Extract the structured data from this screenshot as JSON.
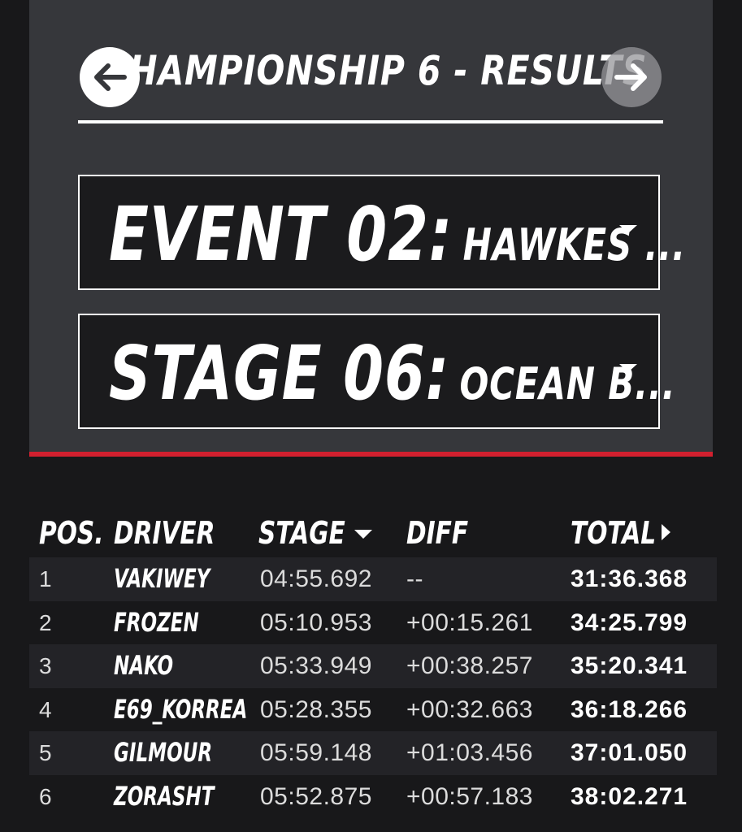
{
  "header": {
    "title": "CHAMPIONSHIP 6 - RESULTS",
    "prev_icon": "arrow-left-icon",
    "next_icon": "arrow-right-icon"
  },
  "event_selector": {
    "label": "EVENT 02:",
    "value": "HAWKES ..."
  },
  "stage_selector": {
    "label": "STAGE 06:",
    "value": "OCEAN B..."
  },
  "colors": {
    "panel": "#36373b",
    "background": "#18181a",
    "accent_red": "#d2202f",
    "row_alt": "#232327"
  },
  "table": {
    "headers": {
      "pos": "POS.",
      "driver": "DRIVER",
      "stage": "STAGE",
      "diff": "DIFF",
      "total": "TOTAL"
    },
    "rows": [
      {
        "pos": "1",
        "driver": "VAKIWEY",
        "stage": "04:55.692",
        "diff": "--",
        "total": "31:36.368"
      },
      {
        "pos": "2",
        "driver": "FROZEN",
        "stage": "05:10.953",
        "diff": "+00:15.261",
        "total": "34:25.799"
      },
      {
        "pos": "3",
        "driver": "NAKO",
        "stage": "05:33.949",
        "diff": "+00:38.257",
        "total": "35:20.341"
      },
      {
        "pos": "4",
        "driver": "E69_KORREA",
        "stage": "05:28.355",
        "diff": "+00:32.663",
        "total": "36:18.266"
      },
      {
        "pos": "5",
        "driver": "GILMOUR",
        "stage": "05:59.148",
        "diff": "+01:03.456",
        "total": "37:01.050"
      },
      {
        "pos": "6",
        "driver": "ZORASHT",
        "stage": "05:52.875",
        "diff": "+00:57.183",
        "total": "38:02.271"
      }
    ]
  }
}
